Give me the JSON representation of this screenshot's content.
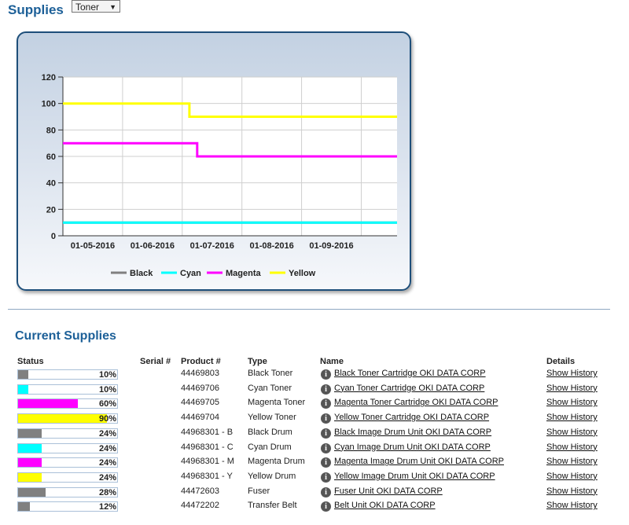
{
  "header": {
    "title": "Supplies",
    "select_value": "Toner"
  },
  "chart_data": {
    "type": "line",
    "x_tick_labels": [
      "01-05-2016",
      "01-06-2016",
      "01-07-2016",
      "01-08-2016",
      "01-09-2016"
    ],
    "ylim": [
      0,
      120
    ],
    "y_ticks": [
      0,
      20,
      40,
      60,
      80,
      100,
      120
    ],
    "grid": true,
    "legend_position": "bottom",
    "series": [
      {
        "name": "Black",
        "color": "#808080",
        "points": [
          [
            0,
            10
          ],
          [
            5.6,
            10
          ]
        ]
      },
      {
        "name": "Cyan",
        "color": "#00ffff",
        "points": [
          [
            0,
            10
          ],
          [
            5.6,
            10
          ]
        ]
      },
      {
        "name": "Magenta",
        "color": "#ff00ff",
        "points": [
          [
            0,
            70
          ],
          [
            2.25,
            70
          ],
          [
            2.25,
            60
          ],
          [
            5.6,
            60
          ]
        ]
      },
      {
        "name": "Yellow",
        "color": "#ffff00",
        "points": [
          [
            0,
            100
          ],
          [
            2.12,
            100
          ],
          [
            2.12,
            90
          ],
          [
            5.6,
            90
          ]
        ]
      }
    ]
  },
  "current_supplies": {
    "title": "Current Supplies",
    "columns": {
      "status": "Status",
      "serial": "Serial #",
      "product": "Product #",
      "type": "Type",
      "name": "Name",
      "details": "Details"
    },
    "rows": [
      {
        "status_pct": 10,
        "status_label": "10%",
        "color": "#808080",
        "serial": "",
        "product": "44469803",
        "type": "Black Toner",
        "name": "Black Toner Cartridge OKI DATA CORP",
        "details": "Show History"
      },
      {
        "status_pct": 10,
        "status_label": "10%",
        "color": "#00ffff",
        "serial": "",
        "product": "44469706",
        "type": "Cyan Toner",
        "name": "Cyan Toner Cartridge OKI DATA CORP",
        "details": "Show History"
      },
      {
        "status_pct": 60,
        "status_label": "60%",
        "color": "#ff00ff",
        "serial": "",
        "product": "44469705",
        "type": "Magenta Toner",
        "name": "Magenta Toner Cartridge OKI DATA CORP",
        "details": "Show History"
      },
      {
        "status_pct": 90,
        "status_label": "90%",
        "color": "#ffff00",
        "serial": "",
        "product": "44469704",
        "type": "Yellow Toner",
        "name": "Yellow Toner Cartridge OKI DATA CORP",
        "details": "Show History"
      },
      {
        "status_pct": 24,
        "status_label": "24%",
        "color": "#808080",
        "serial": "",
        "product": "44968301 - B",
        "type": "Black Drum",
        "name": "Black Image Drum Unit OKI DATA CORP",
        "details": "Show History"
      },
      {
        "status_pct": 24,
        "status_label": "24%",
        "color": "#00ffff",
        "serial": "",
        "product": "44968301 - C",
        "type": "Cyan Drum",
        "name": "Cyan Image Drum Unit OKI DATA CORP",
        "details": "Show History"
      },
      {
        "status_pct": 24,
        "status_label": "24%",
        "color": "#ff00ff",
        "serial": "",
        "product": "44968301 - M",
        "type": "Magenta Drum",
        "name": "Magenta Image Drum Unit OKI DATA CORP",
        "details": "Show History"
      },
      {
        "status_pct": 24,
        "status_label": "24%",
        "color": "#ffff00",
        "serial": "",
        "product": "44968301 - Y",
        "type": "Yellow Drum",
        "name": "Yellow Image Drum Unit OKI DATA CORP",
        "details": "Show History"
      },
      {
        "status_pct": 28,
        "status_label": "28%",
        "color": "#808080",
        "serial": "",
        "product": "44472603",
        "type": "Fuser",
        "name": "Fuser Unit OKI DATA CORP",
        "details": "Show History"
      },
      {
        "status_pct": 12,
        "status_label": "12%",
        "color": "#808080",
        "serial": "",
        "product": "44472202",
        "type": "Transfer Belt",
        "name": "Belt Unit OKI DATA CORP",
        "details": "Show History"
      }
    ]
  }
}
